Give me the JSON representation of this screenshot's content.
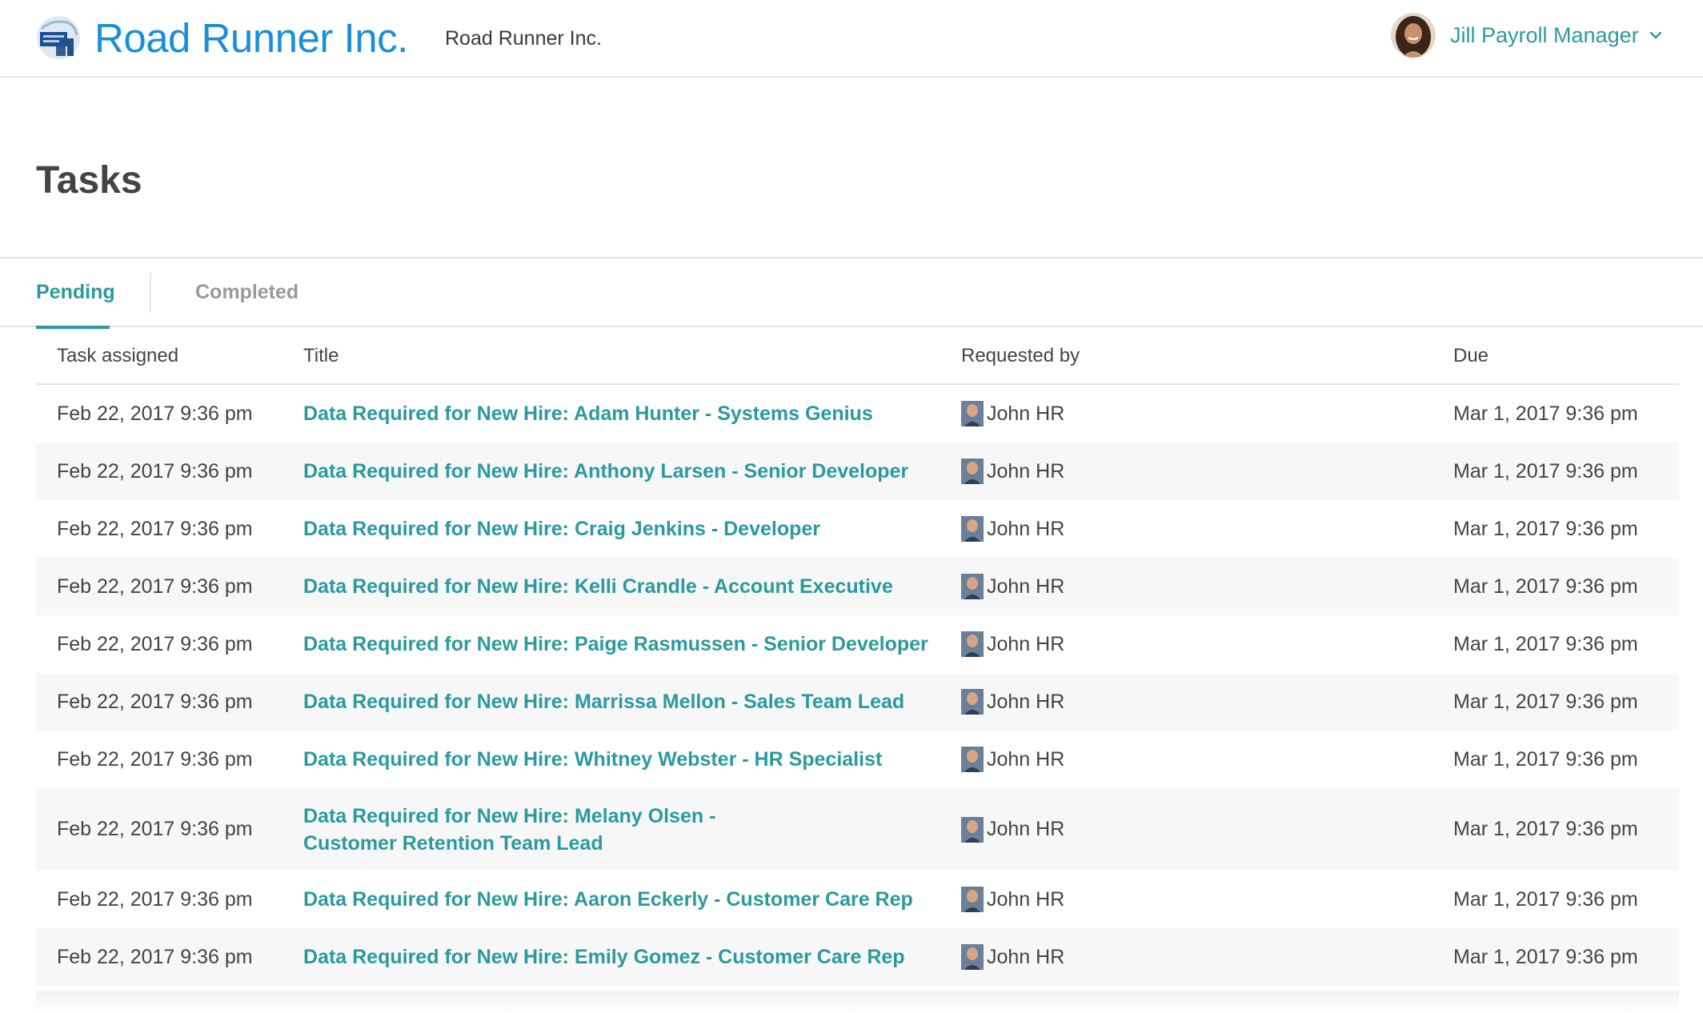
{
  "header": {
    "brand": "Road Runner Inc.",
    "company": "Road Runner Inc.",
    "user_name": "Jill Payroll Manager",
    "logo_icon": "company-logo",
    "dropdown_icon": "chevron-down-icon"
  },
  "page": {
    "title": "Tasks"
  },
  "tabs": [
    {
      "label": "Pending",
      "active": true
    },
    {
      "label": "Completed",
      "active": false
    }
  ],
  "table": {
    "columns": [
      "Task assigned",
      "Title",
      "Requested by",
      "Due"
    ],
    "rows": [
      {
        "assigned": "Feb 22, 2017 9:36 pm",
        "title": "Data Required for New Hire: Adam Hunter - Systems Genius",
        "requested_by": "John HR",
        "due": "Mar 1, 2017 9:36 pm"
      },
      {
        "assigned": "Feb 22, 2017 9:36 pm",
        "title": "Data Required for New Hire: Anthony Larsen - Senior Developer",
        "requested_by": "John HR",
        "due": "Mar 1, 2017 9:36 pm"
      },
      {
        "assigned": "Feb 22, 2017 9:36 pm",
        "title": "Data Required for New Hire: Craig Jenkins - Developer",
        "requested_by": "John HR",
        "due": "Mar 1, 2017 9:36 pm"
      },
      {
        "assigned": "Feb 22, 2017 9:36 pm",
        "title": "Data Required for New Hire: Kelli Crandle - Account Executive",
        "requested_by": "John HR",
        "due": "Mar 1, 2017 9:36 pm"
      },
      {
        "assigned": "Feb 22, 2017 9:36 pm",
        "title": "Data Required for New Hire: Paige Rasmussen - Senior Developer",
        "requested_by": "John HR",
        "due": "Mar 1, 2017 9:36 pm"
      },
      {
        "assigned": "Feb 22, 2017 9:36 pm",
        "title": "Data Required for New Hire: Marrissa Mellon - Sales Team Lead",
        "requested_by": "John HR",
        "due": "Mar 1, 2017 9:36 pm"
      },
      {
        "assigned": "Feb 22, 2017 9:36 pm",
        "title": "Data Required for New Hire: Whitney Webster - HR Specialist",
        "requested_by": "John HR",
        "due": "Mar 1, 2017 9:36 pm"
      },
      {
        "assigned": "Feb 22, 2017 9:36 pm",
        "title": "Data Required for New Hire: Melany Olsen - Customer Retention Team Lead",
        "requested_by": "John HR",
        "due": "Mar 1, 2017 9:36 pm"
      },
      {
        "assigned": "Feb 22, 2017 9:36 pm",
        "title": "Data Required for New Hire: Aaron Eckerly - Customer Care Rep",
        "requested_by": "John HR",
        "due": "Mar 1, 2017 9:36 pm"
      },
      {
        "assigned": "Feb 22, 2017 9:36 pm",
        "title": "Data Required for New Hire: Emily Gomez - Customer Care Rep",
        "requested_by": "John HR",
        "due": "Mar 1, 2017 9:36 pm"
      }
    ]
  },
  "colors": {
    "brand_blue": "#1a8fd8",
    "accent_teal": "#2a9a9e",
    "text": "#444444",
    "stripe": "#f7f7f7",
    "divider": "#e6e6e6"
  }
}
